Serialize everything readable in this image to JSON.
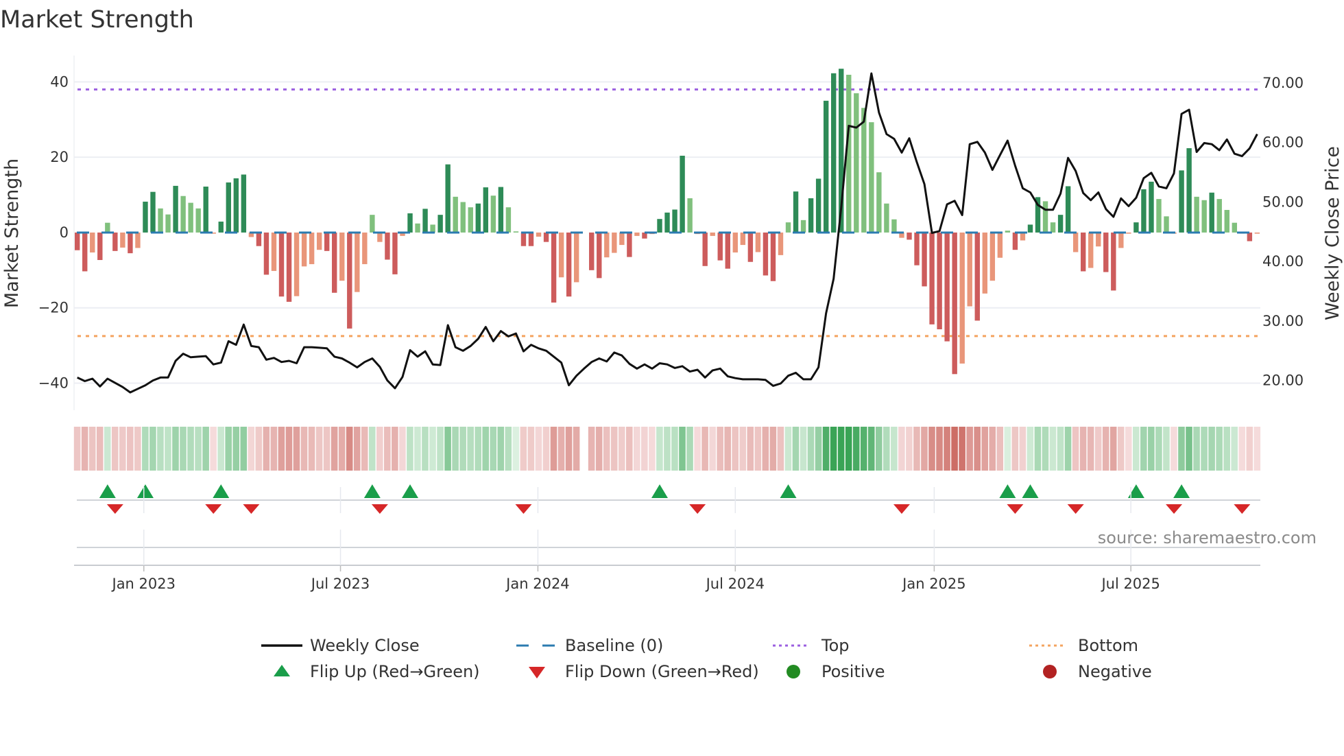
{
  "title": "Market Strength",
  "source": "source: sharemaestro.com",
  "colors": {
    "pos_strong": "#2e8b57",
    "pos_weak": "#80c07d",
    "neg_strong": "#cd5c5c",
    "neg_weak": "#e9967a",
    "baseline": "#2b7bb0",
    "top": "#9b5fe0",
    "bottom": "#f4a460",
    "close": "#111111",
    "flip_up": "#1a9e4a",
    "flip_down": "#d62728",
    "positive": "#228b22",
    "negative": "#b22222"
  },
  "legend": [
    {
      "label": "Weekly Close",
      "symbol": "line"
    },
    {
      "label": "Baseline (0)",
      "symbol": "dash"
    },
    {
      "label": "Top",
      "symbol": "dot-purple"
    },
    {
      "label": "Bottom",
      "symbol": "dot-orange"
    },
    {
      "label": "Flip Up (Red→Green)",
      "symbol": "triangle-up"
    },
    {
      "label": "Flip Down (Green→Red)",
      "symbol": "triangle-down"
    },
    {
      "label": "Positive",
      "symbol": "circle-green"
    },
    {
      "label": "Negative",
      "symbol": "circle-red"
    }
  ],
  "chart_data": {
    "type": "bar",
    "title": "Market Strength",
    "ylabel": "Market Strength",
    "y2label": "Weekly Close Price",
    "xlabel": "",
    "ylim": [
      -47.2,
      47.0
    ],
    "y2lim": [
      15.0,
      74.6
    ],
    "y_ticks": [
      {
        "v": 40,
        "label": "40"
      },
      {
        "v": 20,
        "label": "20"
      },
      {
        "v": 0,
        "label": "0"
      },
      {
        "v": -20,
        "label": "−20"
      },
      {
        "v": -40,
        "label": "−40"
      }
    ],
    "y2_ticks": [
      {
        "v": 70,
        "label": "70.00"
      },
      {
        "v": 60,
        "label": "60.00"
      },
      {
        "v": 50,
        "label": "50.00"
      },
      {
        "v": 40,
        "label": "40.00"
      },
      {
        "v": 30,
        "label": "30.00"
      },
      {
        "v": 20,
        "label": "20.00"
      }
    ],
    "x_unit": "week index",
    "x_ticks": [
      {
        "week": 8.8,
        "label": "Jan 2023"
      },
      {
        "week": 34.8,
        "label": "Jul 2023"
      },
      {
        "week": 60.9,
        "label": "Jan 2024"
      },
      {
        "week": 87.0,
        "label": "Jul 2024"
      },
      {
        "week": 113.3,
        "label": "Jan 2025"
      },
      {
        "week": 139.3,
        "label": "Jul 2025"
      }
    ],
    "top_level": 38,
    "bottom_level": -27.5,
    "baseline": 0,
    "grid": true,
    "legend_position": "bottom",
    "strength": [
      -4.7,
      -10.3,
      -5.3,
      -7.3,
      2.6,
      -4.9,
      -4.0,
      -5.5,
      -4.1,
      8.2,
      10.8,
      6.4,
      4.8,
      12.4,
      9.7,
      7.9,
      6.4,
      12.2,
      -0.3,
      2.9,
      13.3,
      14.4,
      15.4,
      -1.2,
      -3.6,
      -11.2,
      -10.2,
      -17.0,
      -18.4,
      -16.9,
      -9.0,
      -8.4,
      -4.6,
      -4.9,
      -16.0,
      -12.8,
      -25.5,
      -15.8,
      -8.4,
      4.7,
      -2.5,
      -7.2,
      -11.1,
      -0.9,
      5.1,
      2.4,
      6.3,
      2.1,
      4.7,
      18.1,
      9.5,
      8.1,
      6.7,
      7.7,
      12.0,
      9.8,
      12.1,
      6.7,
      0.3,
      -3.6,
      -3.6,
      -1.1,
      -2.5,
      -18.6,
      -11.9,
      -17.0,
      -13.2,
      0,
      -10.0,
      -12.1,
      -6.6,
      -5.4,
      -3.3,
      -6.5,
      -0.9,
      -1.6,
      -0.4,
      3.6,
      5.3,
      6.1,
      20.4,
      9.1,
      -0.4,
      -8.9,
      -0.9,
      -7.4,
      -9.6,
      -5.3,
      -3.3,
      -7.8,
      -5.2,
      -11.4,
      -12.9,
      -6.0,
      2.7,
      10.9,
      3.3,
      9.1,
      14.3,
      35.0,
      42.3,
      43.5,
      41.9,
      37.0,
      33.1,
      29.3,
      16.0,
      7.7,
      3.5,
      -1.4,
      -1.9,
      -8.7,
      -14.3,
      -24.4,
      -25.7,
      -28.9,
      -37.6,
      -34.8,
      -19.6,
      -23.4,
      -16.2,
      -12.8,
      -6.7,
      0.5,
      -4.6,
      -2.1,
      2.1,
      9.4,
      8.3,
      2.7,
      4.7,
      12.3,
      -5.2,
      -10.3,
      -9.4,
      -3.7,
      -10.5,
      -15.4,
      -4.1,
      -0.3,
      2.7,
      11.5,
      13.5,
      8.9,
      4.3,
      -0.3,
      16.5,
      22.4,
      9.5,
      8.6,
      10.6,
      8.9,
      6.0,
      2.6,
      -0.3,
      -2.3,
      -0.3
    ],
    "weekly_close": [
      20.5,
      19.9,
      20.3,
      19.0,
      20.3,
      19.6,
      18.9,
      18.0,
      18.6,
      19.2,
      20.0,
      20.5,
      20.5,
      23.3,
      24.5,
      23.9,
      24.0,
      24.1,
      22.7,
      23.0,
      26.6,
      26.0,
      29.4,
      25.8,
      25.6,
      23.5,
      23.8,
      23.1,
      23.3,
      22.9,
      25.6,
      25.6,
      25.5,
      25.4,
      24.0,
      23.7,
      23.0,
      22.2,
      23.1,
      23.7,
      22.3,
      20.0,
      18.7,
      20.6,
      25.1,
      24.0,
      24.9,
      22.7,
      22.6,
      29.3,
      25.6,
      25.0,
      25.8,
      27.0,
      29.0,
      26.6,
      28.3,
      27.4,
      27.9,
      24.9,
      26.0,
      25.4,
      25.0,
      24.0,
      23.0,
      19.2,
      20.8,
      22.0,
      23.1,
      23.7,
      23.2,
      24.7,
      24.2,
      22.8,
      22.0,
      22.7,
      22.0,
      22.9,
      22.7,
      22.1,
      22.4,
      21.5,
      21.8,
      20.5,
      21.7,
      22.0,
      20.7,
      20.4,
      20.2,
      20.2,
      20.2,
      20.1,
      19.1,
      19.5,
      20.8,
      21.3,
      20.2,
      20.2,
      22.2,
      31.3,
      37.1,
      49.0,
      62.8,
      62.5,
      63.5,
      71.6,
      65.0,
      61.4,
      60.6,
      58.3,
      60.7,
      56.7,
      53.0,
      44.8,
      45.1,
      49.6,
      50.2,
      47.8,
      59.7,
      60.1,
      58.3,
      55.4,
      57.9,
      60.3,
      56.1,
      52.3,
      51.6,
      49.5,
      48.7,
      48.7,
      51.4,
      57.4,
      55.2,
      51.5,
      50.3,
      51.6,
      48.8,
      47.5,
      50.6,
      49.3,
      50.7,
      54.0,
      54.9,
      52.6,
      52.3,
      54.8,
      64.8,
      65.5,
      58.4,
      59.9,
      59.7,
      58.7,
      60.5,
      58.1,
      57.7,
      59.0,
      61.4
    ],
    "flip_up_weeks": [
      4,
      9,
      19,
      39,
      44,
      77,
      94,
      123,
      126,
      140,
      146
    ],
    "flip_down_weeks": [
      5,
      18,
      23,
      40,
      59,
      82,
      109,
      124,
      132,
      145,
      154
    ]
  }
}
